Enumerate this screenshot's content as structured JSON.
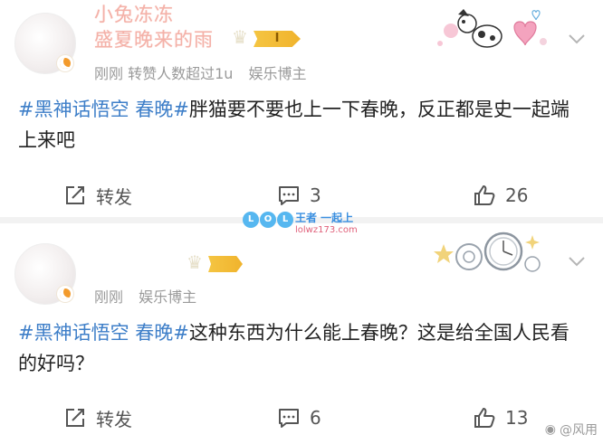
{
  "posts": [
    {
      "username": "盛夏晚来的雨",
      "vip_level": "I",
      "meta": [
        "刚刚 转赞人数超过1u",
        "娱乐博主"
      ],
      "text_parts": [
        {
          "text": "#黑神话悟空 春晚#",
          "type": "hashtag"
        },
        {
          "text": "胖猫要不要也上一下春晚，反正都是史一起端上来吧",
          "type": "plain"
        }
      ],
      "actions": {
        "repost": "转发",
        "comment": "3",
        "like": "26"
      }
    },
    {
      "username": "小兔冻冻",
      "vip_level": "",
      "meta": [
        "刚刚",
        "娱乐博主"
      ],
      "text_parts": [
        {
          "text": "#黑神话悟空 春晚#",
          "type": "hashtag"
        },
        {
          "text": "这种东西为什么能上春晚？这是给全国人民看的好吗？",
          "type": "plain"
        }
      ],
      "actions": {
        "repost": "转发",
        "comment": "6",
        "like": "13"
      }
    }
  ],
  "watermark": {
    "letters": [
      "L",
      "O",
      "L"
    ],
    "title": "王者 一起上",
    "url": "lolwz173.com"
  },
  "credit": "@风用",
  "colors": {
    "hashtag": "#3d7ec8",
    "username": "#f4b1a8",
    "meta": "#9a9a9a",
    "background": "#f2f2f2"
  },
  "icons": {
    "repost": "share-edit-icon",
    "comment": "comment-icon",
    "like": "thumbs-up-icon",
    "more": "chevron-down-icon"
  }
}
